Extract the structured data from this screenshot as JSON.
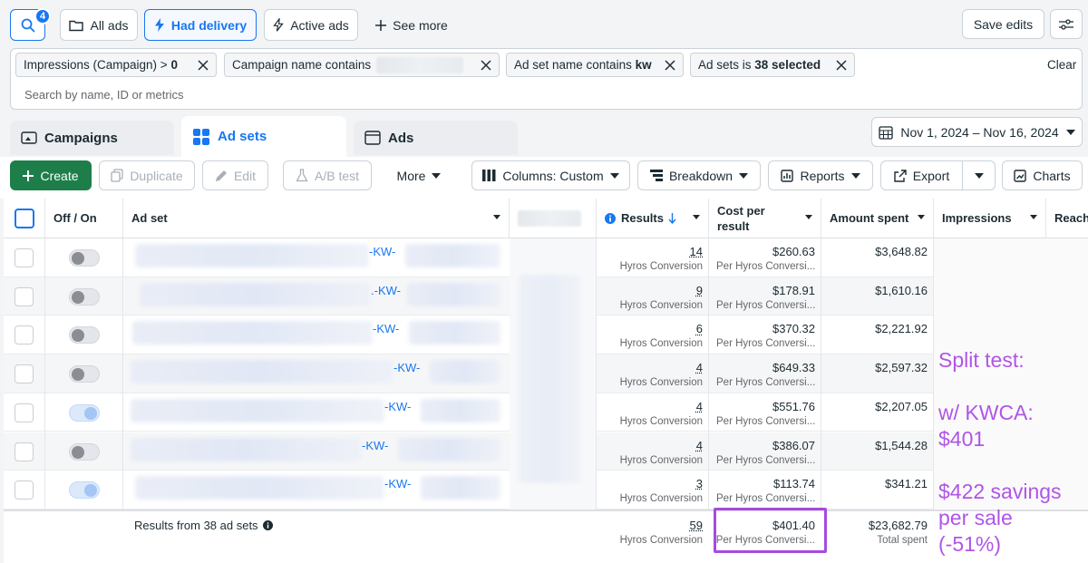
{
  "topbar": {
    "search_badge": "4",
    "chips": [
      "All ads",
      "Had delivery",
      "Active ads"
    ],
    "see_more": "See more",
    "save_edits": "Save edits"
  },
  "filters": {
    "chips": [
      {
        "pre": "Impressions (Campaign) > ",
        "bold": "0"
      },
      {
        "pre": "Campaign name contains",
        "bold": ""
      },
      {
        "pre": "Ad set name contains ",
        "bold": "kw"
      },
      {
        "pre": "Ad sets is ",
        "bold": "38 selected"
      }
    ],
    "clear": "Clear",
    "search_placeholder": "Search by name, ID or metrics"
  },
  "tabs": {
    "campaigns": "Campaigns",
    "adsets": "Ad sets",
    "ads": "Ads"
  },
  "date_range": "Nov 1, 2024 – Nov 16, 2024",
  "toolbar": {
    "create": "Create",
    "duplicate": "Duplicate",
    "edit": "Edit",
    "ab_test": "A/B test",
    "more": "More",
    "columns": "Columns: Custom",
    "breakdown": "Breakdown",
    "reports": "Reports",
    "export": "Export",
    "charts": "Charts"
  },
  "table": {
    "headers": {
      "offon": "Off / On",
      "adset": "Ad set",
      "results": "Results",
      "cpr_1": "Cost per",
      "cpr_2": "result",
      "amount": "Amount spent",
      "impressions": "Impressions",
      "reach": "Reach"
    },
    "rows": [
      {
        "kw": "-KW-",
        "on": false,
        "results": "14",
        "results_sub": "Hyros Conversion",
        "cpr": "$260.63",
        "cpr_sub": "Per Hyros Conversi...",
        "spent": "$3,648.82"
      },
      {
        "kw": ".-KW-",
        "on": false,
        "results": "9",
        "results_sub": "Hyros Conversion",
        "cpr": "$178.91",
        "cpr_sub": "Per Hyros Conversi...",
        "spent": "$1,610.16"
      },
      {
        "kw": "-KW-",
        "on": false,
        "results": "6",
        "results_sub": "Hyros Conversion",
        "cpr": "$370.32",
        "cpr_sub": "Per Hyros Conversi...",
        "spent": "$2,221.92"
      },
      {
        "kw": "-KW-",
        "on": false,
        "results": "4",
        "results_sub": "Hyros Conversion",
        "cpr": "$649.33",
        "cpr_sub": "Per Hyros Conversi...",
        "spent": "$2,597.32"
      },
      {
        "kw": "-KW-",
        "on": true,
        "results": "4",
        "results_sub": "Hyros Conversion",
        "cpr": "$551.76",
        "cpr_sub": "Per Hyros Conversi...",
        "spent": "$2,207.05"
      },
      {
        "kw": "-KW-",
        "on": false,
        "results": "4",
        "results_sub": "Hyros Conversion",
        "cpr": "$386.07",
        "cpr_sub": "Per Hyros Conversi...",
        "spent": "$1,544.28"
      },
      {
        "kw": "-KW-",
        "on": true,
        "results": "3",
        "results_sub": "Hyros Conversion",
        "cpr": "$113.74",
        "cpr_sub": "Per Hyros Conversi...",
        "spent": "$341.21"
      }
    ],
    "summary": {
      "label": "Results from 38 ad sets",
      "results": "59",
      "results_sub": "Hyros Conversion",
      "cpr": "$401.40",
      "cpr_sub": "Per Hyros Conversi...",
      "spent": "$23,682.79",
      "spent_sub": "Total spent"
    }
  },
  "annotation": {
    "l1": "Split test:",
    "l2": "w/ KWCA:",
    "l3": "$401",
    "l4": "$422 savings",
    "l5": "per sale",
    "l6": "(-51%)"
  },
  "colors": {
    "accent": "#1877f2",
    "create": "#1e7e4a",
    "annotation": "#b055e6"
  }
}
